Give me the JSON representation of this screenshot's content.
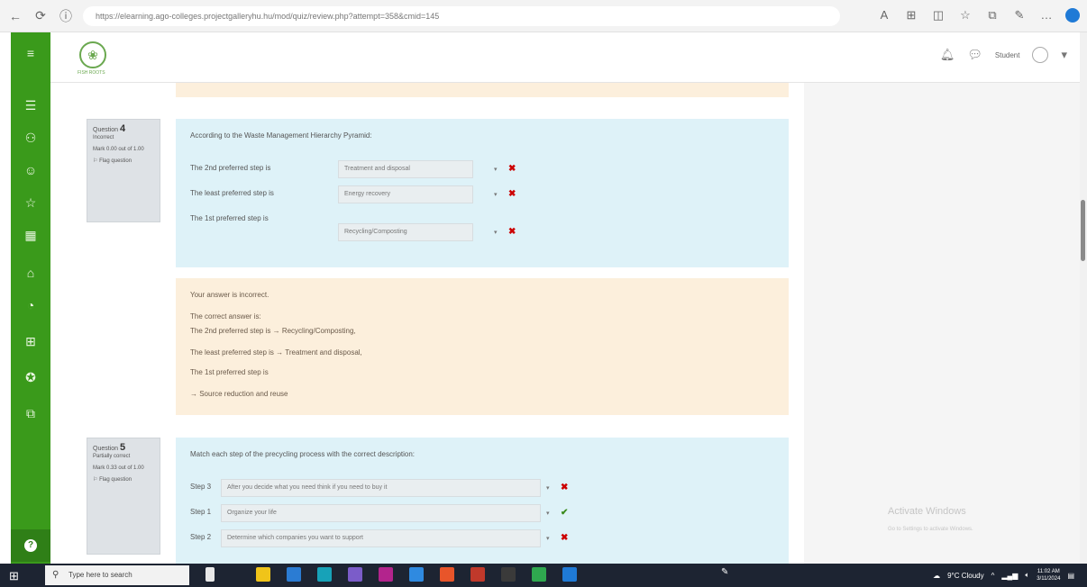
{
  "browser": {
    "url": "https://elearning.ago-colleges.projectgalleryhu.hu/mod/quiz/review.php?attempt=358&cmid=145"
  },
  "header": {
    "logo_text": "FISH ROOTS",
    "username": "Student"
  },
  "question4": {
    "number_label": "Question",
    "number": "4",
    "status": "Incorrect",
    "mark": "Mark 0.00 out of 1.00",
    "flag": "Flag question",
    "prompt": "According to the Waste Management Hierarchy Pyramid:",
    "rows": [
      {
        "label": "The 2nd preferred step is",
        "selected": "Treatment and disposal",
        "correct": false
      },
      {
        "label": "The least preferred step is",
        "selected": "Energy recovery",
        "correct": false
      },
      {
        "label": "The 1st preferred step is",
        "selected": "Recycling/Composting",
        "correct": false
      }
    ]
  },
  "feedback": {
    "incorrect": "Your answer is incorrect.",
    "correct_intro": "The correct answer is:",
    "lines": [
      "The 2nd preferred step is → Recycling/Composting,",
      "The least preferred step is → Treatment and disposal,",
      "The 1st preferred step is",
      "→ Source reduction and reuse"
    ]
  },
  "question5": {
    "number_label": "Question",
    "number": "5",
    "status": "Partially correct",
    "mark": "Mark 0.33 out of 1.00",
    "flag": "Flag question",
    "prompt": "Match each step of the precycling process with the correct description:",
    "rows": [
      {
        "label": "Step 3",
        "selected": "After you decide what you need think if you need to buy it",
        "correct": false
      },
      {
        "label": "Step 1",
        "selected": "Organize your life",
        "correct": true
      },
      {
        "label": "Step 2",
        "selected": "Determine which companies you want to support",
        "correct": false
      }
    ]
  },
  "windows": {
    "activate_title": "Activate Windows",
    "activate_sub": "Go to Settings to activate Windows."
  },
  "taskbar": {
    "search_placeholder": "Type here to search",
    "weather": "9°C Cloudy",
    "time": "11:02 AM",
    "date": "3/11/2024"
  }
}
